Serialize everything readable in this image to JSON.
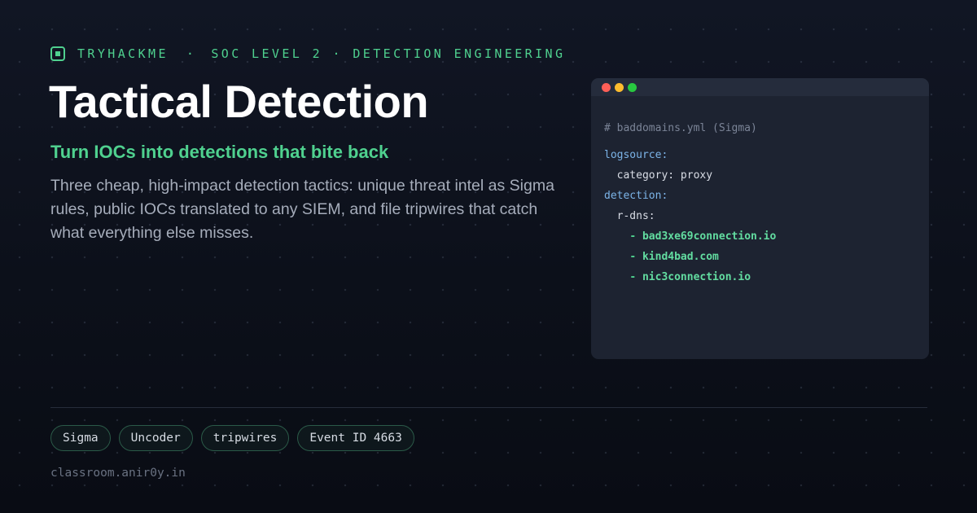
{
  "header": {
    "brand": "TRYHACKME",
    "separator": "·",
    "breadcrumb": "SOC LEVEL 2 · DETECTION ENGINEERING",
    "accent_color": "#4fd18f",
    "logo_icon": "square-logo-icon"
  },
  "hero": {
    "title": "Tactical Detection",
    "subtitle": "Turn IOCs into detections that bite back",
    "description": "Three cheap, high-impact detection tactics: unique threat intel as Sigma rules, public IOCs translated to any SIEM, and file tripwires that catch what everything else misses."
  },
  "code_window": {
    "window_controls": [
      "red",
      "yellow",
      "green"
    ],
    "comment": "# baddomains.yml (Sigma)",
    "logsource_key": "logsource:",
    "category_line": "category: proxy",
    "detection_key": "detection:",
    "rdns_key": "r-dns:",
    "dash": "-",
    "iocs": [
      "bad3xe69connection.io",
      "kind4bad.com",
      "nic3connection.io"
    ]
  },
  "tags": [
    "Sigma",
    "Uncoder",
    "tripwires",
    "Event ID 4663"
  ],
  "footer": {
    "url": "classroom.anir0y.in"
  }
}
